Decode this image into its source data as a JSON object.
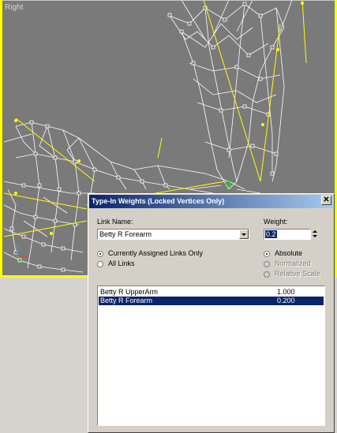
{
  "viewport": {
    "label": "Right",
    "colors": {
      "background": "#7a7a7a",
      "wire": "#ffffff",
      "bone": "#ffff00",
      "selected": "#00ff00"
    }
  },
  "dialog": {
    "title": "Type-In Weights (Locked Vertices Only)",
    "close_icon": "close-icon",
    "link_name_label": "Link Name:",
    "link_name_value": "Betty R Forearm",
    "weight_label": "Weight:",
    "weight_value": "0.2",
    "radios": {
      "currently_assigned": "Currently Assigned Links Only",
      "all_links": "All Links",
      "absolute": "Absolute",
      "normalized": "Normalized",
      "relative_scale": "Relative Scale"
    },
    "links": [
      {
        "name": "Betty R UpperArm",
        "weight": "1.000"
      },
      {
        "name": "Betty R Forearm",
        "weight": "0.200"
      }
    ],
    "selected_index": 1
  }
}
